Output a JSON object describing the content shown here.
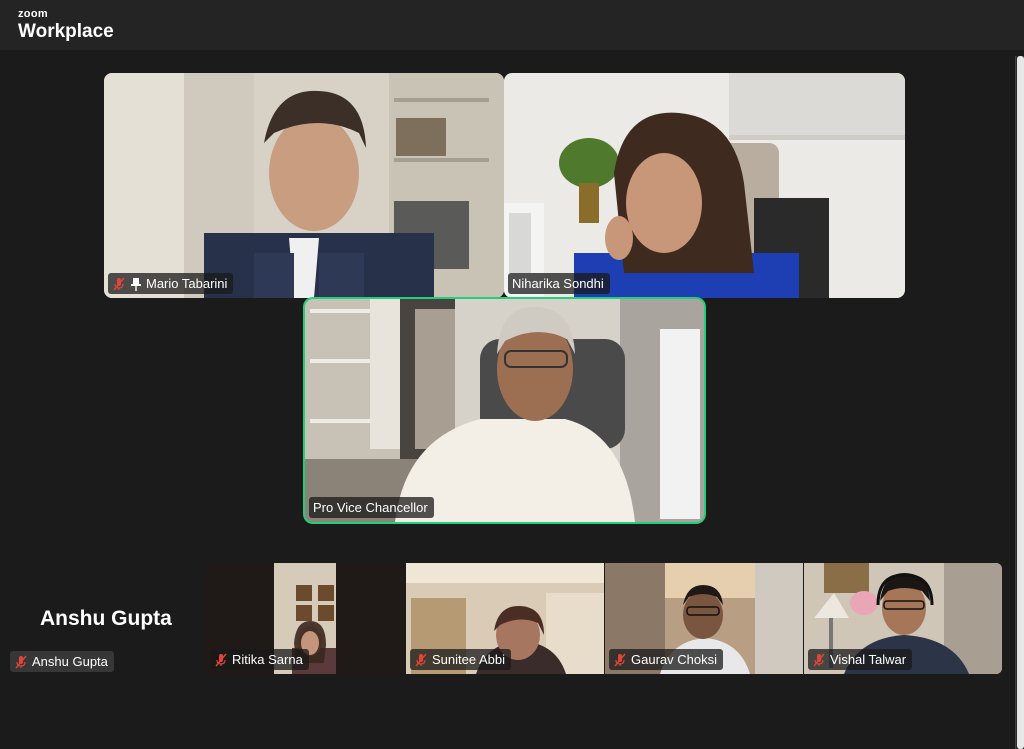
{
  "app": {
    "brand_small": "zoom",
    "brand_large": "Workplace"
  },
  "colors": {
    "active_speaker": "#21d07a",
    "muted_icon": "#e0453a"
  },
  "participants": {
    "mario": {
      "name": "Mario Tabarini",
      "muted": true,
      "pinned": true
    },
    "niharika": {
      "name": "Niharika Sondhi",
      "muted": false
    },
    "pvc": {
      "name": "Pro Vice Chancellor",
      "muted": false,
      "active_speaker": true
    },
    "anshu": {
      "name": "Anshu Gupta",
      "muted": true,
      "video": false,
      "display_name": "Anshu Gupta"
    },
    "ritika": {
      "name": "Ritika Sarna",
      "muted": true
    },
    "sunitee": {
      "name": "Sunitee Abbi",
      "muted": true
    },
    "gaurav": {
      "name": "Gaurav Choksi",
      "muted": true
    },
    "vishal": {
      "name": "Vishal Talwar",
      "muted": true
    }
  }
}
